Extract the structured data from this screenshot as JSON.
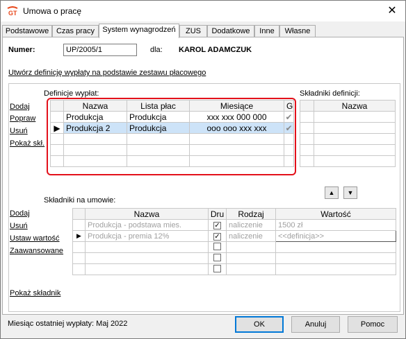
{
  "window": {
    "title": "Umowa o pracę",
    "close_glyph": "✕",
    "icon": "app-logo-icon"
  },
  "tabs": [
    {
      "label": "Podstawowe",
      "active": false
    },
    {
      "label": "Czas pracy",
      "active": false
    },
    {
      "label": "System wynagrodzeń",
      "active": true
    },
    {
      "label": "ZUS",
      "active": false
    },
    {
      "label": "Dodatkowe",
      "active": false
    },
    {
      "label": "Inne",
      "active": false
    },
    {
      "label": "Własne",
      "active": false
    }
  ],
  "header": {
    "number_label": "Numer:",
    "number_value": "UP/2005/1",
    "for_label": "dla:",
    "employee_name": "KAROL ADAMCZUK"
  },
  "create_link": "Utwórz definicję wypłaty na podstawie zestawu płacowego",
  "definitions": {
    "title": "Definicje wypłat:",
    "actions": [
      "Dodaj",
      "Popraw",
      "Usuń",
      "Pokaż skł."
    ],
    "columns": [
      "Nazwa",
      "Lista płac",
      "Miesiące",
      "G"
    ],
    "rows": [
      {
        "nazwa": "Produkcja",
        "lista": "Produkcja",
        "miesiace": "xxx xxx 000 000",
        "g": "✔",
        "selected": false
      },
      {
        "nazwa": "Produkcja 2",
        "lista": "Produkcja",
        "miesiace": "ooo ooo xxx xxx",
        "g": "✔",
        "selected": true
      }
    ]
  },
  "def_components": {
    "title": "Składniki definicji:",
    "columns": [
      "Nazwa"
    ]
  },
  "move_buttons": {
    "up": "▲",
    "down": "▼"
  },
  "contract_components": {
    "title": "Składniki na umowie:",
    "actions": [
      "Dodaj",
      "Usuń",
      "Ustaw wartość",
      "Zaawansowane"
    ],
    "columns": [
      "Nazwa",
      "Dru",
      "Rodzaj",
      "Wartość"
    ],
    "rows": [
      {
        "nazwa": "Produkcja - podstawa mies.",
        "dru": "✓",
        "rodzaj": "naliczenie",
        "wartosc": "1500 zł",
        "selected": false
      },
      {
        "nazwa": "Produkcja - premia 12%",
        "dru": "✓",
        "rodzaj": "naliczenie",
        "wartosc": "<<definicja>>",
        "selected": true
      }
    ]
  },
  "show_component_link": "Pokaż składnik",
  "footer": {
    "last_payment": "Miesiąc ostatniej wypłaty: Maj 2022",
    "ok": "OK",
    "cancel": "Anuluj",
    "help": "Pomoc"
  },
  "colors": {
    "selection": "#cde3f8",
    "highlight_frame": "#e3101a",
    "default_button_border": "#0078d7"
  }
}
